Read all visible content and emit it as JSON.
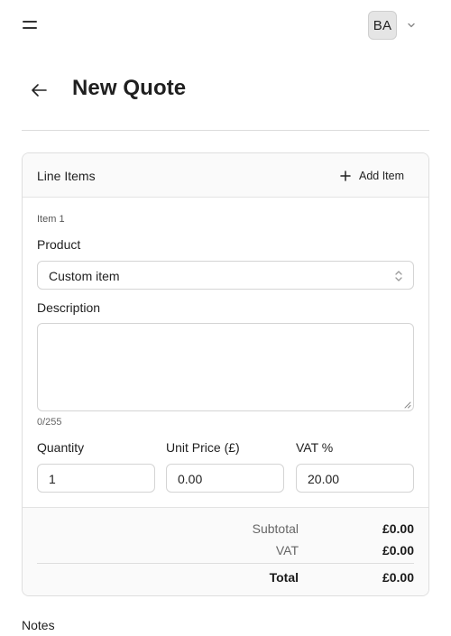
{
  "topbar": {
    "avatar_initials": "BA"
  },
  "header": {
    "title": "New Quote"
  },
  "line_items": {
    "title": "Line Items",
    "add_label": "Add Item",
    "item": {
      "label": "Item 1",
      "product_label": "Product",
      "product_value": "Custom item",
      "description_label": "Description",
      "description_value": "",
      "char_counter": "0/255",
      "quantity_label": "Quantity",
      "quantity_value": "1",
      "unit_price_label": "Unit Price (£)",
      "unit_price_value": "0.00",
      "vat_label": "VAT %",
      "vat_value": "20.00"
    },
    "totals": {
      "subtotal_label": "Subtotal",
      "subtotal_value": "£0.00",
      "vat_label": "VAT",
      "vat_value": "£0.00",
      "total_label": "Total",
      "total_value": "£0.00"
    }
  },
  "notes": {
    "label": "Notes"
  },
  "icons": {
    "menu": "menu-icon",
    "user_menu": "chevron-down-icon",
    "back": "arrow-left-icon",
    "add": "plus-icon",
    "select": "chevron-up-down-icon",
    "resize": "resize-handle-icon"
  }
}
